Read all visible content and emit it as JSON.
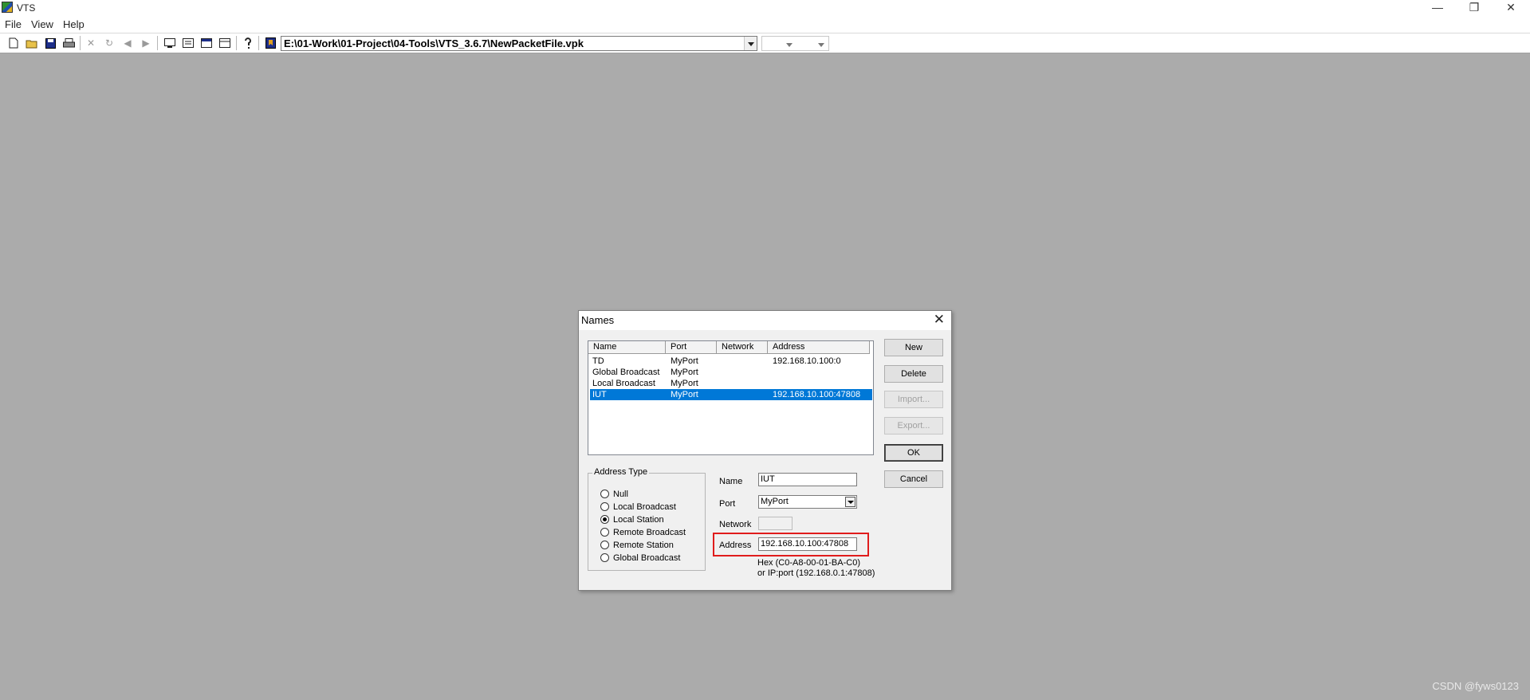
{
  "window": {
    "title": "VTS",
    "controls": {
      "minimize": "—",
      "restore": "❐",
      "close": "✕"
    }
  },
  "menu": {
    "items": [
      "File",
      "View",
      "Help"
    ]
  },
  "toolbar": {
    "icons": [
      "new-file-icon",
      "open-folder-icon",
      "save-icon",
      "print-icon",
      "delete-icon",
      "refresh-icon",
      "back-arrow-icon",
      "forward-arrow-icon",
      "monitor-icon",
      "names-icon",
      "window-icon",
      "panel-icon",
      "help-icon",
      "bookmark-icon"
    ],
    "path": "E:\\01-Work\\01-Project\\04-Tools\\VTS_3.6.7\\NewPacketFile.vpk"
  },
  "dialog": {
    "title": "Names",
    "columns": [
      "Name",
      "Port",
      "Network",
      "Address"
    ],
    "rows": [
      {
        "name": "TD",
        "port": "MyPort",
        "network": "",
        "address": "192.168.10.100:0"
      },
      {
        "name": "Global Broadcast",
        "port": "MyPort",
        "network": "",
        "address": ""
      },
      {
        "name": "Local Broadcast",
        "port": "MyPort",
        "network": "",
        "address": ""
      },
      {
        "name": "IUT",
        "port": "MyPort",
        "network": "",
        "address": "192.168.10.100:47808"
      }
    ],
    "selected_row": "IUT",
    "buttons": {
      "new": "New",
      "delete": "Delete",
      "import": "Import...",
      "export": "Export...",
      "ok": "OK",
      "cancel": "Cancel"
    },
    "address_type": {
      "label": "Address Type",
      "options": [
        "Null",
        "Local Broadcast",
        "Local Station",
        "Remote Broadcast",
        "Remote Station",
        "Global Broadcast"
      ],
      "selected": "Local Station"
    },
    "fields": {
      "name_label": "Name",
      "name_value": "IUT",
      "port_label": "Port",
      "port_value": "MyPort",
      "network_label": "Network",
      "network_value": "",
      "address_label": "Address",
      "address_value": "192.168.10.100:47808"
    },
    "hints": {
      "hex": "Hex  (C0-A8-00-01-BA-C0)",
      "ipport": "or IP:port (192.168.0.1:47808)"
    },
    "highlight_color": "#e01c1c",
    "selection_color": "#0078d7"
  },
  "watermark": "CSDN @fyws0123"
}
